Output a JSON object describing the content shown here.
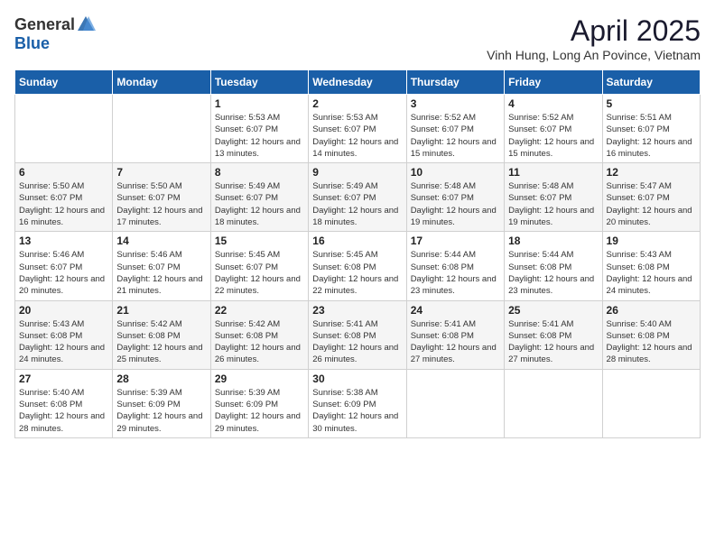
{
  "logo": {
    "general": "General",
    "blue": "Blue"
  },
  "title": "April 2025",
  "subtitle": "Vinh Hung, Long An Povince, Vietnam",
  "days_of_week": [
    "Sunday",
    "Monday",
    "Tuesday",
    "Wednesday",
    "Thursday",
    "Friday",
    "Saturday"
  ],
  "weeks": [
    [
      {
        "day": "",
        "info": ""
      },
      {
        "day": "",
        "info": ""
      },
      {
        "day": "1",
        "info": "Sunrise: 5:53 AM\nSunset: 6:07 PM\nDaylight: 12 hours\nand 13 minutes."
      },
      {
        "day": "2",
        "info": "Sunrise: 5:53 AM\nSunset: 6:07 PM\nDaylight: 12 hours\nand 14 minutes."
      },
      {
        "day": "3",
        "info": "Sunrise: 5:52 AM\nSunset: 6:07 PM\nDaylight: 12 hours\nand 15 minutes."
      },
      {
        "day": "4",
        "info": "Sunrise: 5:52 AM\nSunset: 6:07 PM\nDaylight: 12 hours\nand 15 minutes."
      },
      {
        "day": "5",
        "info": "Sunrise: 5:51 AM\nSunset: 6:07 PM\nDaylight: 12 hours\nand 16 minutes."
      }
    ],
    [
      {
        "day": "6",
        "info": "Sunrise: 5:50 AM\nSunset: 6:07 PM\nDaylight: 12 hours\nand 16 minutes."
      },
      {
        "day": "7",
        "info": "Sunrise: 5:50 AM\nSunset: 6:07 PM\nDaylight: 12 hours\nand 17 minutes."
      },
      {
        "day": "8",
        "info": "Sunrise: 5:49 AM\nSunset: 6:07 PM\nDaylight: 12 hours\nand 18 minutes."
      },
      {
        "day": "9",
        "info": "Sunrise: 5:49 AM\nSunset: 6:07 PM\nDaylight: 12 hours\nand 18 minutes."
      },
      {
        "day": "10",
        "info": "Sunrise: 5:48 AM\nSunset: 6:07 PM\nDaylight: 12 hours\nand 19 minutes."
      },
      {
        "day": "11",
        "info": "Sunrise: 5:48 AM\nSunset: 6:07 PM\nDaylight: 12 hours\nand 19 minutes."
      },
      {
        "day": "12",
        "info": "Sunrise: 5:47 AM\nSunset: 6:07 PM\nDaylight: 12 hours\nand 20 minutes."
      }
    ],
    [
      {
        "day": "13",
        "info": "Sunrise: 5:46 AM\nSunset: 6:07 PM\nDaylight: 12 hours\nand 20 minutes."
      },
      {
        "day": "14",
        "info": "Sunrise: 5:46 AM\nSunset: 6:07 PM\nDaylight: 12 hours\nand 21 minutes."
      },
      {
        "day": "15",
        "info": "Sunrise: 5:45 AM\nSunset: 6:07 PM\nDaylight: 12 hours\nand 22 minutes."
      },
      {
        "day": "16",
        "info": "Sunrise: 5:45 AM\nSunset: 6:08 PM\nDaylight: 12 hours\nand 22 minutes."
      },
      {
        "day": "17",
        "info": "Sunrise: 5:44 AM\nSunset: 6:08 PM\nDaylight: 12 hours\nand 23 minutes."
      },
      {
        "day": "18",
        "info": "Sunrise: 5:44 AM\nSunset: 6:08 PM\nDaylight: 12 hours\nand 23 minutes."
      },
      {
        "day": "19",
        "info": "Sunrise: 5:43 AM\nSunset: 6:08 PM\nDaylight: 12 hours\nand 24 minutes."
      }
    ],
    [
      {
        "day": "20",
        "info": "Sunrise: 5:43 AM\nSunset: 6:08 PM\nDaylight: 12 hours\nand 24 minutes."
      },
      {
        "day": "21",
        "info": "Sunrise: 5:42 AM\nSunset: 6:08 PM\nDaylight: 12 hours\nand 25 minutes."
      },
      {
        "day": "22",
        "info": "Sunrise: 5:42 AM\nSunset: 6:08 PM\nDaylight: 12 hours\nand 26 minutes."
      },
      {
        "day": "23",
        "info": "Sunrise: 5:41 AM\nSunset: 6:08 PM\nDaylight: 12 hours\nand 26 minutes."
      },
      {
        "day": "24",
        "info": "Sunrise: 5:41 AM\nSunset: 6:08 PM\nDaylight: 12 hours\nand 27 minutes."
      },
      {
        "day": "25",
        "info": "Sunrise: 5:41 AM\nSunset: 6:08 PM\nDaylight: 12 hours\nand 27 minutes."
      },
      {
        "day": "26",
        "info": "Sunrise: 5:40 AM\nSunset: 6:08 PM\nDaylight: 12 hours\nand 28 minutes."
      }
    ],
    [
      {
        "day": "27",
        "info": "Sunrise: 5:40 AM\nSunset: 6:08 PM\nDaylight: 12 hours\nand 28 minutes."
      },
      {
        "day": "28",
        "info": "Sunrise: 5:39 AM\nSunset: 6:09 PM\nDaylight: 12 hours\nand 29 minutes."
      },
      {
        "day": "29",
        "info": "Sunrise: 5:39 AM\nSunset: 6:09 PM\nDaylight: 12 hours\nand 29 minutes."
      },
      {
        "day": "30",
        "info": "Sunrise: 5:38 AM\nSunset: 6:09 PM\nDaylight: 12 hours\nand 30 minutes."
      },
      {
        "day": "",
        "info": ""
      },
      {
        "day": "",
        "info": ""
      },
      {
        "day": "",
        "info": ""
      }
    ]
  ]
}
